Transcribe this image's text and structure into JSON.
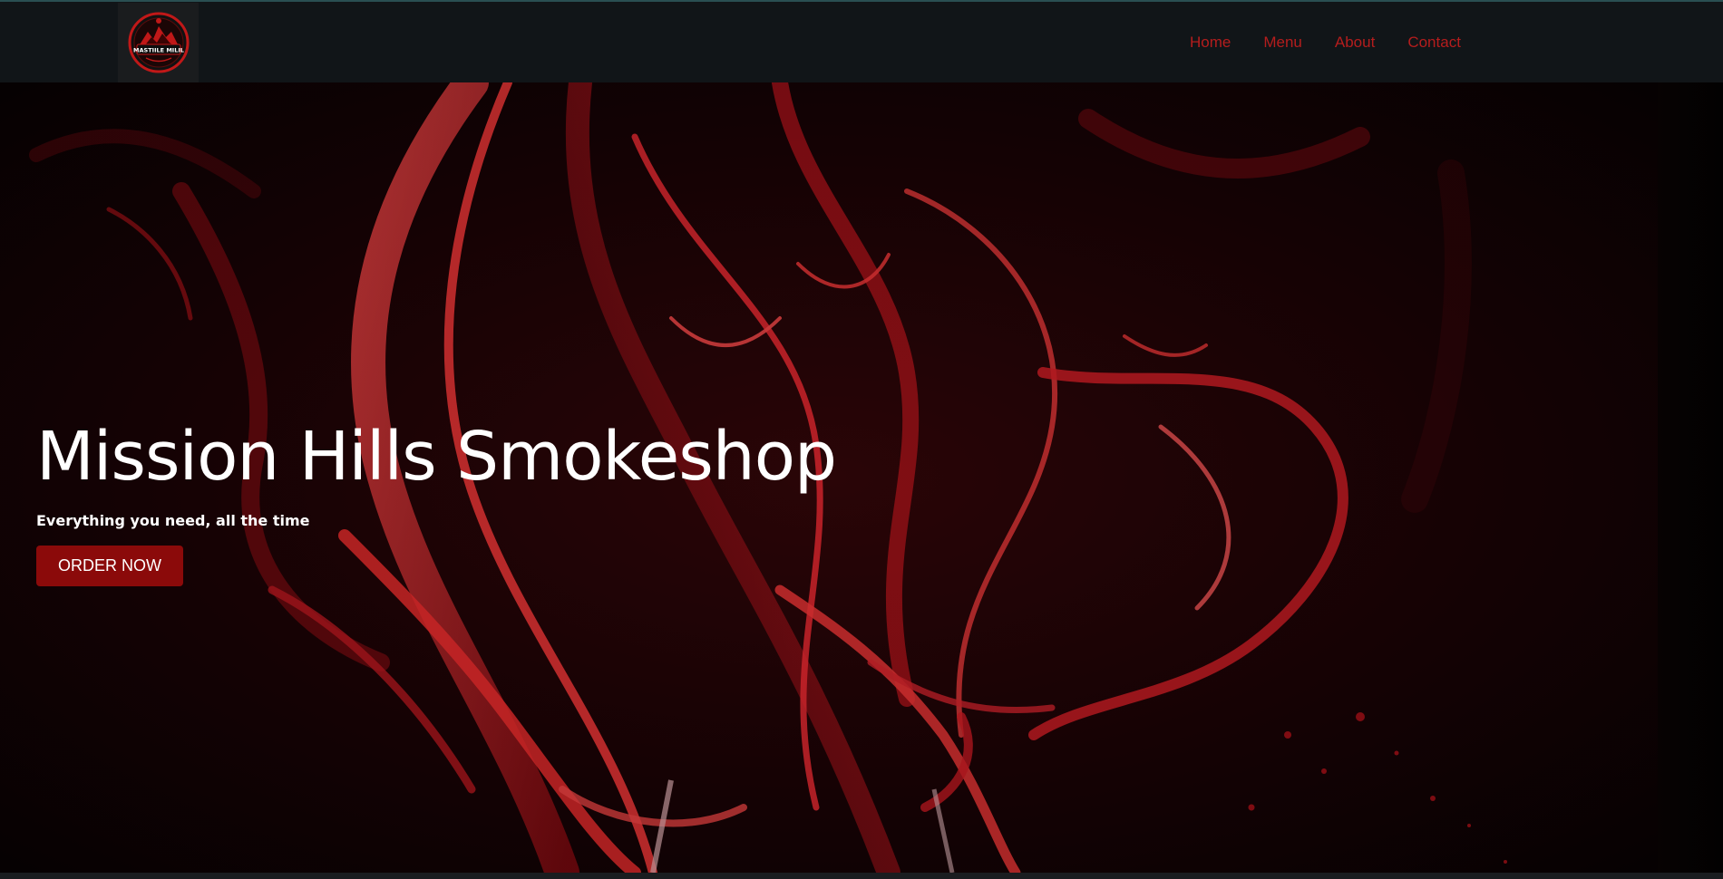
{
  "header": {
    "logo_text": "MASTIILE MILIL",
    "logo_alt_icon": "shop-logo",
    "nav": [
      {
        "label": "Home"
      },
      {
        "label": "Menu"
      },
      {
        "label": "About"
      },
      {
        "label": "Contact"
      }
    ]
  },
  "hero": {
    "title": "Mission Hills Smokeshop",
    "subtitle": "Everything you need, all the time",
    "cta_label": "ORDER NOW",
    "background_icon": "red-smoke-artwork"
  },
  "colors": {
    "nav_bg": "#111518",
    "nav_link": "#b51d1d",
    "accent": "#8b0a0a",
    "hero_text": "#ffffff"
  }
}
